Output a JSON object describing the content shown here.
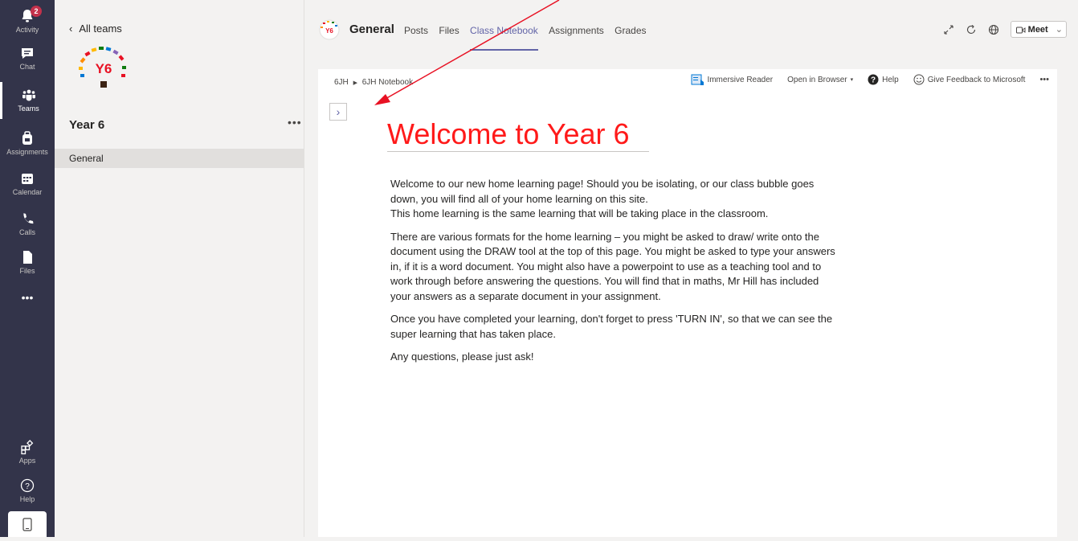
{
  "rail": {
    "activity_label": "Activity",
    "activity_badge": "2",
    "chat_label": "Chat",
    "teams_label": "Teams",
    "assignments_label": "Assignments",
    "calendar_label": "Calendar",
    "calls_label": "Calls",
    "files_label": "Files",
    "more_label": "•••",
    "apps_label": "Apps",
    "help_label": "Help"
  },
  "team_pane": {
    "back_label": "All teams",
    "logo_text": "Y6",
    "team_name": "Year 6",
    "more": "•••",
    "channel": "General"
  },
  "header": {
    "logo_text": "Y6",
    "channel_title": "General",
    "tabs": [
      "Posts",
      "Files",
      "Class Notebook",
      "Assignments",
      "Grades"
    ],
    "active_tab": "Class Notebook",
    "meet_label": "Meet"
  },
  "notebook_toolbar": {
    "breadcrumb_section": "6JH",
    "breadcrumb_notebook": "6JH Notebook",
    "immersive_reader": "Immersive Reader",
    "open_in_browser": "Open in Browser",
    "help": "Help",
    "feedback": "Give Feedback to Microsoft",
    "more": "•••"
  },
  "page": {
    "expand_glyph": "›",
    "title": "Welcome to Year 6",
    "paragraphs": [
      "Welcome to our new home learning page! Should you be isolating, or our class bubble goes down, you will find all of your home learning on this site.",
      "This home learning is the same learning that will be taking place in the classroom.",
      "There are various formats for the home learning – you might be asked to draw/ write onto the document using the DRAW tool at the top of this page. You might be asked to type your answers in, if it is a word document. You might also have a powerpoint to use as a teaching tool and to work through before answering the questions. You will find that in maths, Mr Hill has included your answers as a separate document in your assignment.",
      "Once you have completed your learning, don't forget to press 'TURN IN', so that we can see the super learning that has taken place.",
      "Any questions, please just ask!"
    ]
  },
  "colors": {
    "rail": "#33344a",
    "accent": "#6264a7",
    "heading": "#ff1a1a",
    "annotation_arrow": "#e81123"
  }
}
